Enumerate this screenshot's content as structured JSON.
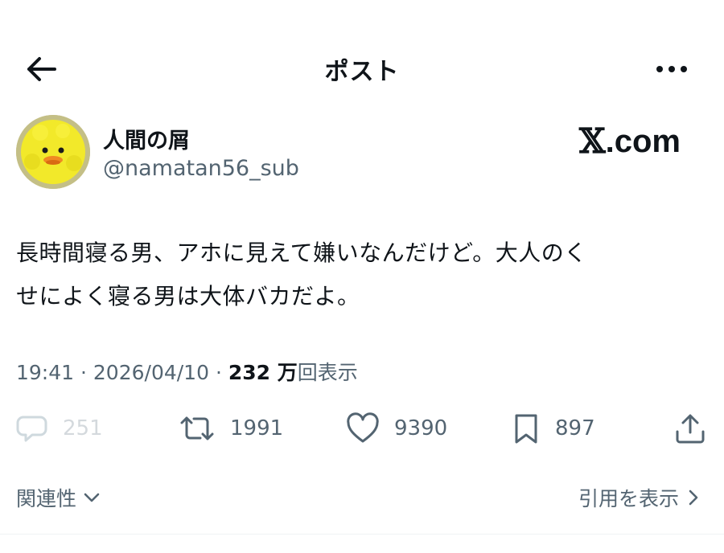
{
  "header": {
    "title": "ポスト",
    "back_icon": "arrow-left-icon",
    "more_icon": "more-horizontal-icon"
  },
  "author": {
    "display_name": "人間の屑",
    "handle": "@namatan56_sub",
    "avatar": "yellow-duckling-avatar"
  },
  "watermark": {
    "x": "𝕏",
    "domain": ".com"
  },
  "tweet": {
    "text_line1": "長時間寝る男、アホに見えて嫌いなんだけど。大人のく",
    "text_line2": "せによく寝る男は大体バカだよ。"
  },
  "meta": {
    "time": "19:41",
    "separator": "·",
    "date": "2026/04/10",
    "views_count": "232 万",
    "views_label": "回表示"
  },
  "actions": {
    "replies": "251",
    "reposts": "1991",
    "likes": "9390",
    "bookmarks": "897"
  },
  "footer": {
    "related_label": "関連性",
    "quotes_label": "引用を表示"
  },
  "colors": {
    "text": "#0f1419",
    "secondary": "#536471",
    "disabled": "#cfd9de"
  }
}
